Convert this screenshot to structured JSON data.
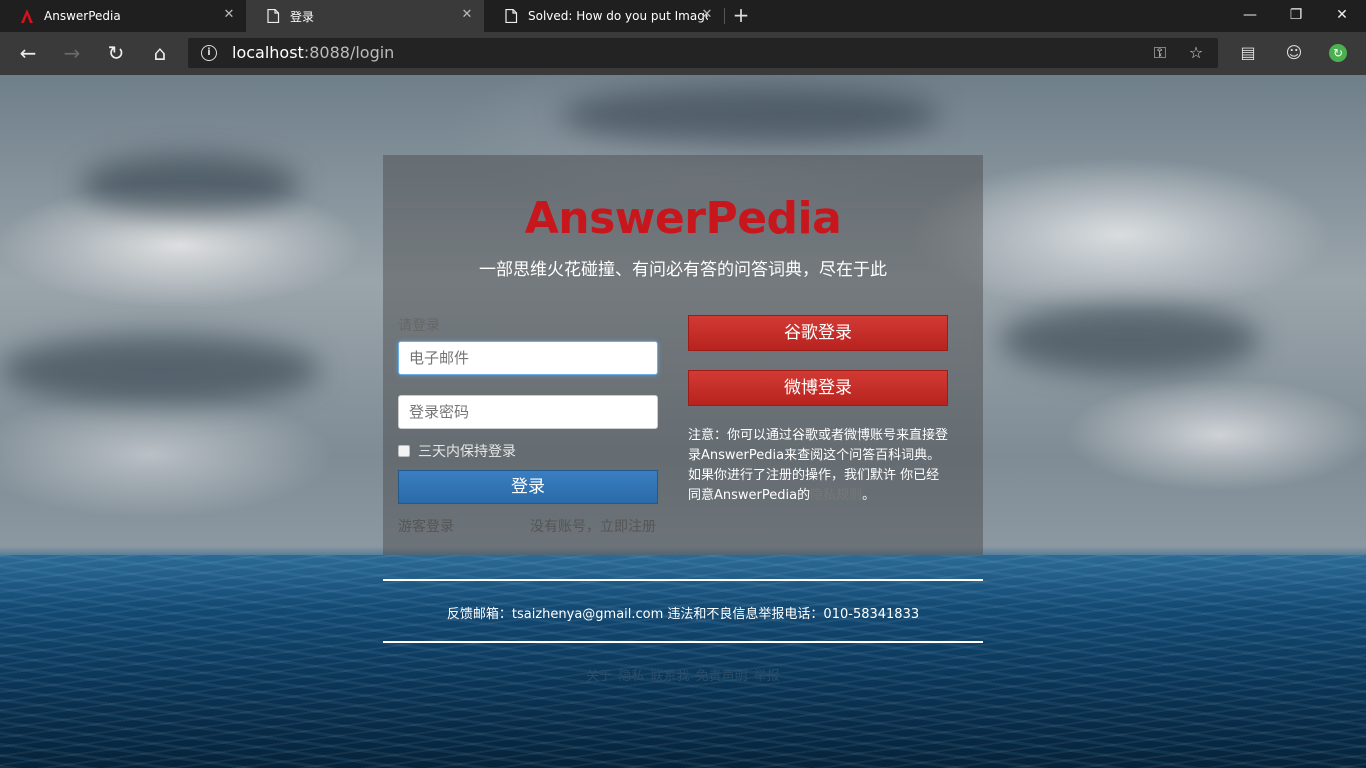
{
  "browser": {
    "tabs": [
      {
        "title": "AnswerPedia",
        "icon": "answerpedia-favicon"
      },
      {
        "title": "登录",
        "icon": "page-icon"
      },
      {
        "title": "Solved: How do you put Images",
        "icon": "page-icon"
      }
    ],
    "url_host": "localhost",
    "url_rest": ":8088/login",
    "window_controls": {
      "minimize": "—",
      "maximize": "❐",
      "close": "✕"
    }
  },
  "page": {
    "logo": "AnswerPedia",
    "slogan": "一部思维火花碰撞、有问必有答的问答词典，尽在于此",
    "login_hint": "请登录",
    "email_placeholder": "电子邮件",
    "password_placeholder": "登录密码",
    "remember_label": "三天内保持登录",
    "login_button": "登录",
    "guest_link": "游客登录",
    "register_link": "没有账号，立即注册",
    "google_button": "谷歌登录",
    "weibo_button": "微博登录",
    "notice_text": "注意：你可以通过谷歌或者微博账号来直接登录AnswerPedia来查阅这个问答百科词典。如果你进行了注册的操作，我们默许 你已经同意AnswerPedia的",
    "notice_link": "隐私规则",
    "notice_end": "。",
    "feedback": "反馈邮箱：tsaizhenya@gmail.com 违法和不良信息举报电话：010-58341833",
    "footer_links": [
      "关于",
      "隐私",
      "联系我",
      "免责声明",
      "举报"
    ]
  },
  "colors": {
    "brand_red": "#c8161d",
    "login_blue": "#2a6aa8",
    "social_red": "#c22a25"
  }
}
